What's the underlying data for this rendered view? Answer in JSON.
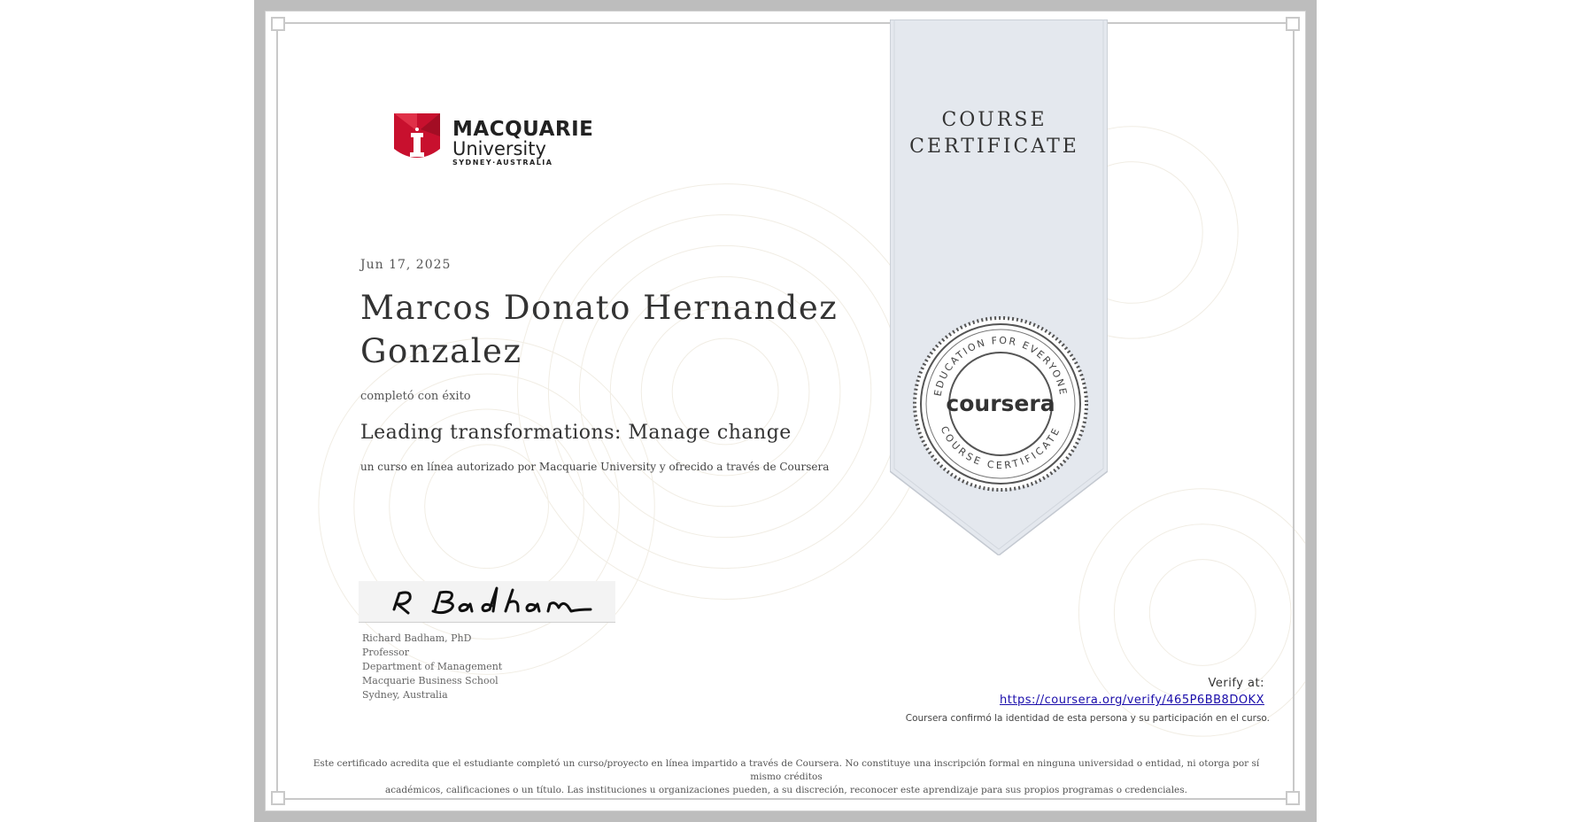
{
  "logo": {
    "line1": "MACQUARIE",
    "line2": "University",
    "line3": "SYDNEY·AUSTRALIA"
  },
  "certificate": {
    "date": "Jun 17, 2025",
    "recipient_name": "Marcos Donato Hernandez Gonzalez",
    "completed_label": "completó con éxito",
    "course_title": "Leading transformations: Manage change",
    "description": "un curso en línea autorizado por Macquarie University y ofrecido a través de Coursera"
  },
  "signer": {
    "name": "Richard Badham, PhD",
    "title": "Professor",
    "department": "Department of Management",
    "school": "Macquarie Business School",
    "location": "Sydney, Australia"
  },
  "ribbon": {
    "line1": "COURSE",
    "line2": "CERTIFICATE"
  },
  "seal": {
    "top_text": "EDUCATION FOR EVERYONE",
    "bottom_text": "COURSE CERTIFICATE",
    "brand": "coursera"
  },
  "verify": {
    "label": "Verify at:",
    "url": "https://coursera.org/verify/465P6BB8DOKX",
    "note": "Coursera confirmó la identidad de esta persona y su participación en el curso."
  },
  "disclaimer": {
    "line1": "Este certificado acredita que el estudiante completó un curso/proyecto en línea impartido a través de Coursera. No constituye una inscripción formal en ninguna universidad o entidad, ni otorga por sí mismo créditos",
    "line2": "académicos, calificaciones o un título. Las instituciones u organizaciones pueden, a su discreción, reconocer este aprendizaje para sus propios programas o credenciales."
  },
  "colors": {
    "frame": "#bdbdbd",
    "ribbon": "#e4e8ee",
    "macquarie_red": "#c8102e",
    "link": "#1a0dab"
  }
}
